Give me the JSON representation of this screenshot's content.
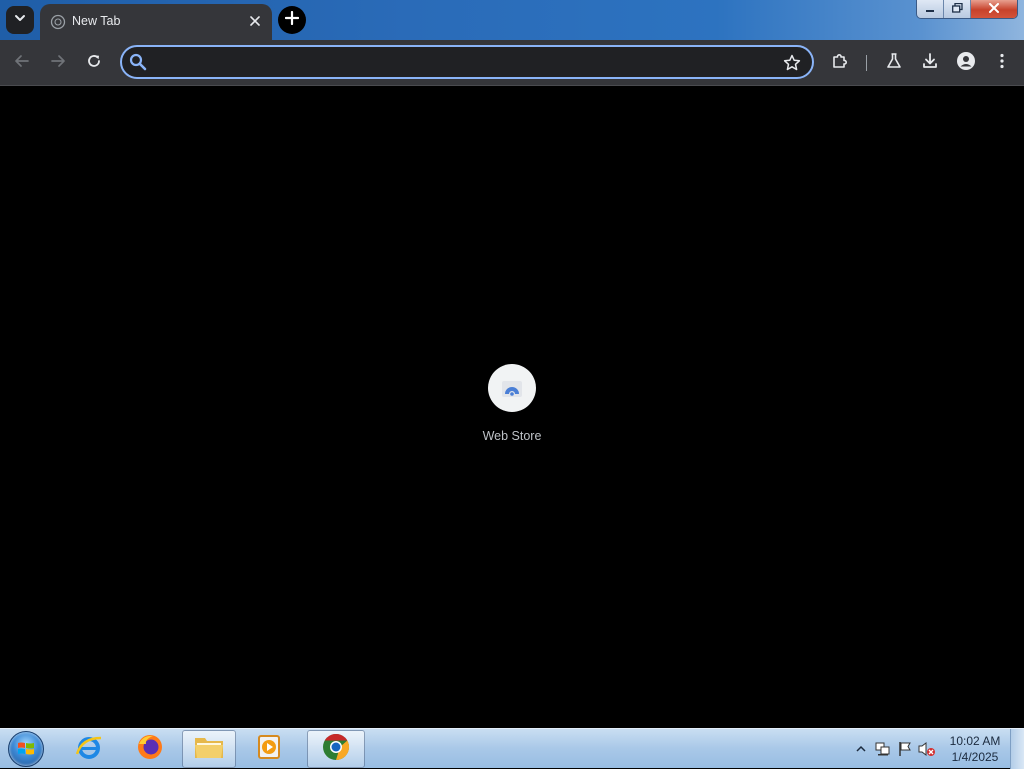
{
  "window": {
    "tab_search_icon": "chevron-down-icon",
    "tab": {
      "title": "New Tab",
      "favicon": "globe-icon",
      "close_icon": "close-icon"
    },
    "new_tab_icon": "plus-icon",
    "controls": [
      "minimize-icon",
      "restore-icon",
      "close-icon"
    ]
  },
  "toolbar": {
    "back_icon": "arrow-left-icon",
    "forward_icon": "arrow-right-icon",
    "reload_icon": "reload-icon",
    "omnibox": {
      "value": "",
      "placeholder": "",
      "search_icon": "search-icon",
      "bookmark_icon": "star-icon"
    },
    "extensions_icon": "puzzle-icon",
    "labs_icon": "flask-icon",
    "downloads_icon": "download-icon",
    "profile_icon": "person-icon",
    "menu_icon": "kebab-icon"
  },
  "content": {
    "shortcuts": [
      {
        "label": "Web Store",
        "icon": "web-store-icon"
      }
    ]
  },
  "taskbar": {
    "start_icon": "windows-logo-icon",
    "pinned": [
      {
        "name": "internet-explorer",
        "icon": "ie-icon",
        "open": false
      },
      {
        "name": "firefox",
        "icon": "firefox-icon",
        "open": false
      },
      {
        "name": "file-explorer",
        "icon": "folder-icon",
        "open": true
      },
      {
        "name": "media-player",
        "icon": "media-player-icon",
        "open": false
      },
      {
        "name": "chrome",
        "icon": "chrome-icon",
        "open": true
      }
    ],
    "tray": {
      "icons": [
        "show-hidden-icon",
        "network-icon",
        "action-center-flag-icon",
        "volume-muted-icon"
      ],
      "time": "10:02 AM",
      "date": "1/4/2025"
    }
  },
  "colors": {
    "tab_bg": "#35363a",
    "omnibox_border": "#8ab4f8",
    "content_bg": "#000000"
  }
}
